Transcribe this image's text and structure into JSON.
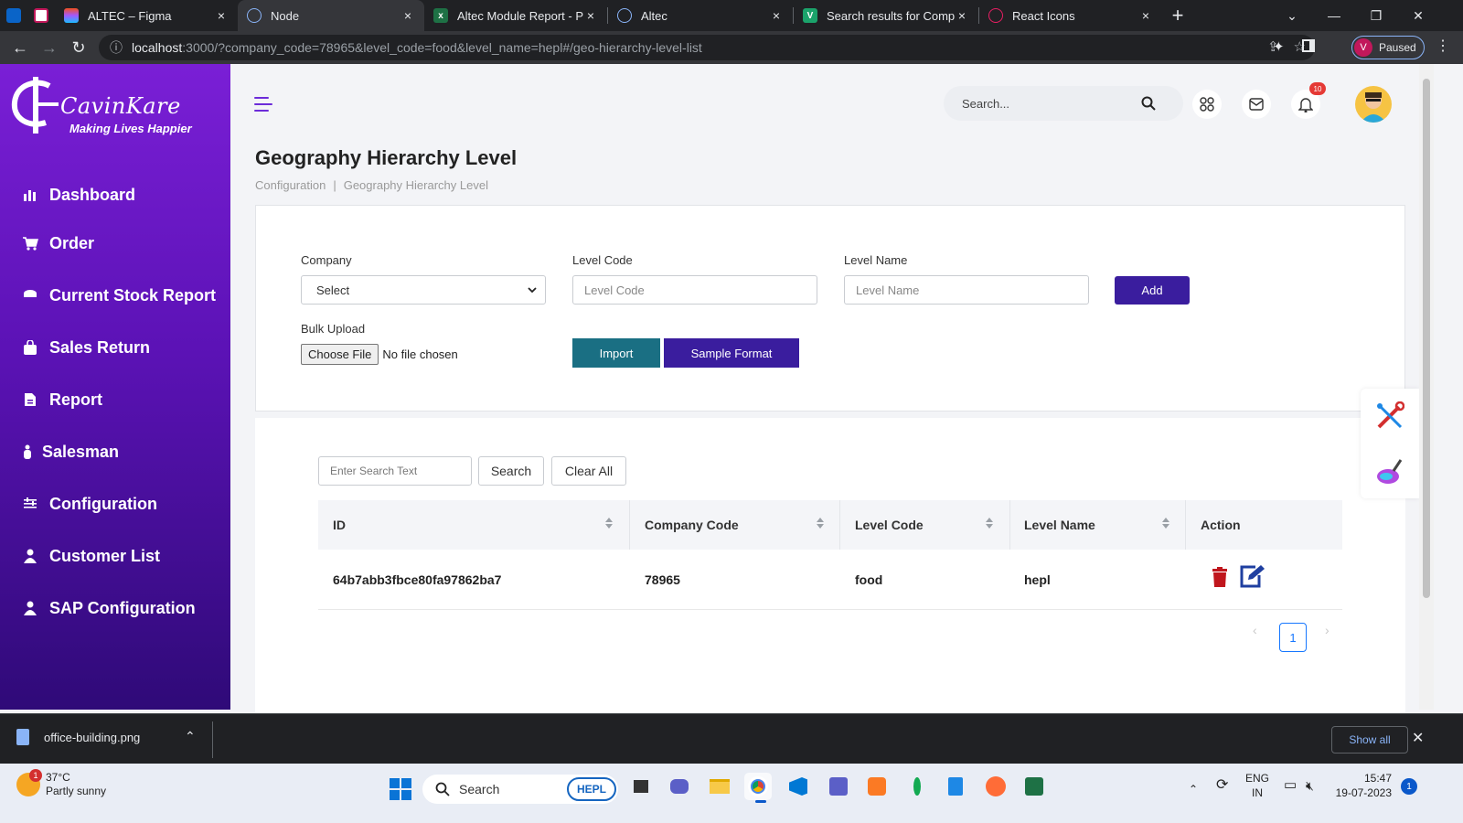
{
  "browser": {
    "tabs": [
      {
        "title": "ALTEC – Figma",
        "close": "×"
      },
      {
        "title": "Node",
        "close": "×"
      },
      {
        "title": "Altec Module Report - Pha",
        "close": "×"
      },
      {
        "title": "Altec",
        "close": "×"
      },
      {
        "title": "Search results for Company",
        "close": "×"
      },
      {
        "title": "React Icons",
        "close": "×"
      }
    ],
    "new_tab": "+",
    "url_host": "localhost",
    "url_rest": ":3000/?company_code=78965&level_code=food&level_name=hepl#/geo-hierarchy-level-list",
    "profile_initial": "V",
    "profile_status": "Paused"
  },
  "brand": {
    "name": "CavinKare",
    "tagline": "Making Lives Happier"
  },
  "sidebar": {
    "items": [
      {
        "label": "Dashboard",
        "icon": "chart-icon"
      },
      {
        "label": "Order",
        "icon": "cart-icon"
      },
      {
        "label": "Current Stock Report",
        "icon": "stack-icon"
      },
      {
        "label": "Sales Return",
        "icon": "bag-icon"
      },
      {
        "label": "Report",
        "icon": "document-icon"
      },
      {
        "label": "Salesman",
        "icon": "person-icon"
      },
      {
        "label": "Configuration",
        "icon": "sliders-icon"
      },
      {
        "label": "Customer List",
        "icon": "user-icon"
      },
      {
        "label": "SAP Configuration",
        "icon": "user-icon"
      }
    ]
  },
  "header": {
    "search_placeholder": "Search...",
    "notification_count": "10"
  },
  "page": {
    "title": "Geography Hierarchy Level",
    "breadcrumb": [
      "Configuration",
      "|",
      "Geography Hierarchy Level"
    ]
  },
  "form": {
    "company_label": "Company",
    "company_value": "Select",
    "level_code_label": "Level Code",
    "level_code_placeholder": "Level Code",
    "level_name_label": "Level Name",
    "level_name_placeholder": "Level Name",
    "add_label": "Add",
    "bulk_upload_label": "Bulk Upload",
    "choose_file_label": "Choose File",
    "no_file_label": "No file chosen",
    "import_label": "Import",
    "sample_format_label": "Sample Format"
  },
  "table": {
    "search_placeholder": "Enter Search Text",
    "search_button": "Search",
    "clear_button": "Clear All",
    "columns": [
      "ID",
      "Company Code",
      "Level Code",
      "Level Name",
      "Action"
    ],
    "rows": [
      {
        "id": "64b7abb3fbce80fa97862ba7",
        "company_code": "78965",
        "level_code": "food",
        "level_name": "hepl"
      }
    ],
    "current_page": "1",
    "prev": "‹",
    "next": "›"
  },
  "downloads": {
    "file_name": "office-building.png",
    "show_all": "Show all",
    "close": "✕"
  },
  "taskbar": {
    "temperature": "37°C",
    "weather": "Partly sunny",
    "search_label": "Search",
    "search_badge": "HEPL",
    "weather_badge": "1",
    "lang_1": "ENG",
    "lang_2": "IN",
    "time": "15:47",
    "date": "19-07-2023",
    "notification_count": "1"
  },
  "colors": {
    "sidebar_top": "#7a1fd6",
    "sidebar_bottom": "#2f0a78",
    "primary_button": "#3a1d9e",
    "import_button": "#1a6f83",
    "delete_icon": "#c0161d",
    "edit_icon": "#1f3fa0"
  }
}
